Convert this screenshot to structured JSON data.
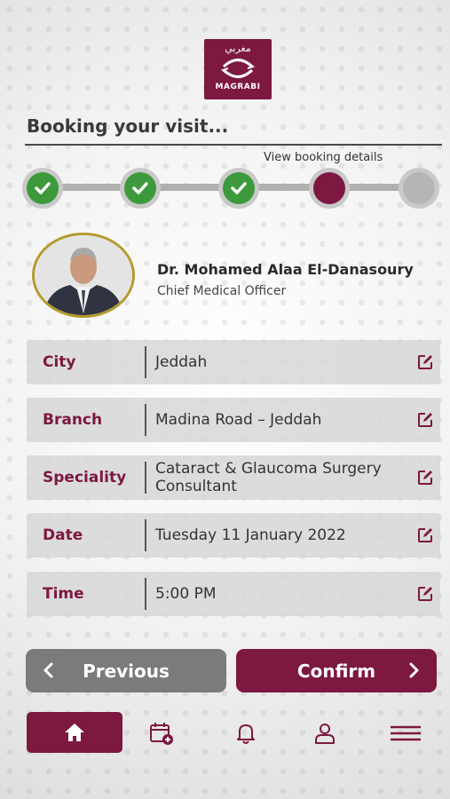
{
  "logo": {
    "arabic": "مغربي",
    "english": "MAGRABI"
  },
  "page": {
    "title": "Booking your visit...",
    "view_details": "View booking details"
  },
  "stepper": {
    "steps": [
      "done",
      "done",
      "done",
      "current",
      "todo"
    ]
  },
  "doctor": {
    "name": "Dr. Mohamed Alaa El-Danasoury",
    "position": "Chief Medical Officer"
  },
  "fields": [
    {
      "label": "City",
      "value": "Jeddah"
    },
    {
      "label": "Branch",
      "value": "Madina Road – Jeddah"
    },
    {
      "label": "Speciality",
      "value": "Cataract & Glaucoma Surgery Consultant"
    },
    {
      "label": "Date",
      "value": "Tuesday 11 January 2022"
    },
    {
      "label": "Time",
      "value": "5:00 PM"
    }
  ],
  "buttons": {
    "previous": "Previous",
    "confirm": "Confirm"
  },
  "nav": {
    "items": [
      "home-icon",
      "calendar-add-icon",
      "bell-icon",
      "user-icon",
      "menu-icon"
    ],
    "active": "home-icon"
  },
  "colors": {
    "brand": "#7d1840",
    "success": "#3c9a3c",
    "inactive": "#b5b5b5",
    "secondary_button": "#7b7b7b"
  }
}
